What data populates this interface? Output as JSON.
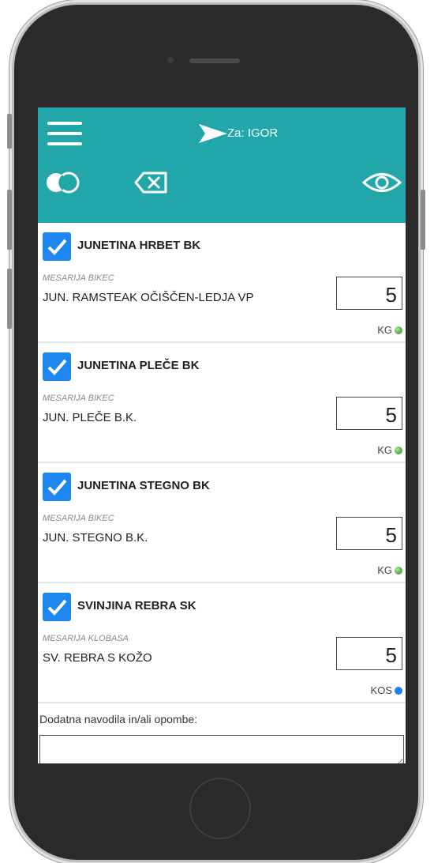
{
  "header": {
    "recipient_label": "Za: IGOR",
    "background_color": "#21a7a9"
  },
  "icons": {
    "menu": "hamburger-menu-icon",
    "send": "send-arrow-icon",
    "toggle": "toggle-circles-icon",
    "clear": "backspace-x-icon",
    "view": "eye-icon"
  },
  "items": [
    {
      "title": "JUNETINA HRBET BK",
      "supplier": "MESARIJA BIKEC",
      "product": "JUN. RAMSTEAK OČIŠČEN-LEDJA VP",
      "quantity": "5",
      "unit": "KG",
      "checked": true,
      "status_color": "#54b84a"
    },
    {
      "title": "JUNETINA PLEČE BK",
      "supplier": "MESARIJA BIKEC",
      "product": "JUN. PLEČE B.K.",
      "quantity": "5",
      "unit": "KG",
      "checked": true,
      "status_color": "#54b84a"
    },
    {
      "title": "JUNETINA STEGNO BK",
      "supplier": "MESARIJA BIKEC",
      "product": "JUN. STEGNO B.K.",
      "quantity": "5",
      "unit": "KG",
      "checked": true,
      "status_color": "#54b84a"
    },
    {
      "title": "SVINJINA REBRA SK",
      "supplier": "MESARIJA KLOBASA",
      "product": "SV. REBRA S KOŽO",
      "quantity": "5",
      "unit": "KOS",
      "checked": true,
      "status_color": "#1d7ff0"
    }
  ],
  "notes": {
    "label": "Dodatna navodila in/ali opombe:",
    "value": ""
  },
  "colors": {
    "checkbox": "#1d86ef"
  }
}
